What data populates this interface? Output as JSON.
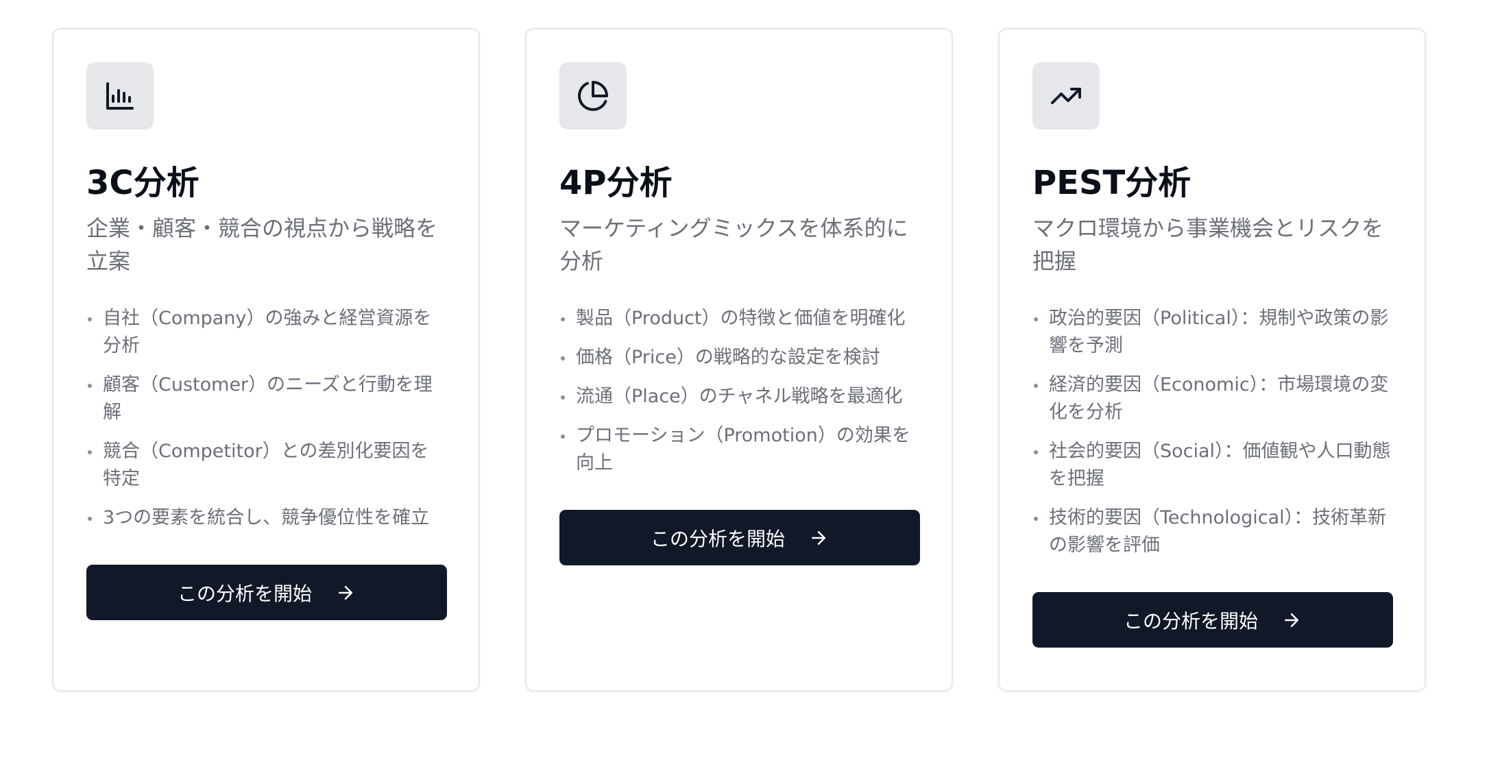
{
  "cards": [
    {
      "icon": "bar-chart-icon",
      "title": "3C分析",
      "subtitle": "企業・顧客・競合の視点から戦略を立案",
      "items": [
        "自社（Company）の強みと経営資源を分析",
        "顧客（Customer）のニーズと行動を理解",
        "競合（Competitor）との差別化要因を特定",
        "3つの要素を統合し、競争優位性を確立"
      ],
      "button": "この分析を開始"
    },
    {
      "icon": "pie-chart-icon",
      "title": "4P分析",
      "subtitle": "マーケティングミックスを体系的に分析",
      "items": [
        "製品（Product）の特徴と価値を明確化",
        "価格（Price）の戦略的な設定を検討",
        "流通（Place）のチャネル戦略を最適化",
        "プロモーション（Promotion）の効果を向上"
      ],
      "button": "この分析を開始"
    },
    {
      "icon": "trending-up-icon",
      "title": "PEST分析",
      "subtitle": "マクロ環境から事業機会とリスクを把握",
      "items": [
        "政治的要因（Political）：規制や政策の影響を予測",
        "経済的要因（Economic）：市場環境の変化を分析",
        "社会的要因（Social）：価値観や人口動態を把握",
        "技術的要因（Technological）：技術革新の影響を評価"
      ],
      "button": "この分析を開始"
    }
  ],
  "colors": {
    "button_bg": "#111827",
    "icon_bg": "#e6e7ea",
    "muted_text": "#6b6f78"
  }
}
